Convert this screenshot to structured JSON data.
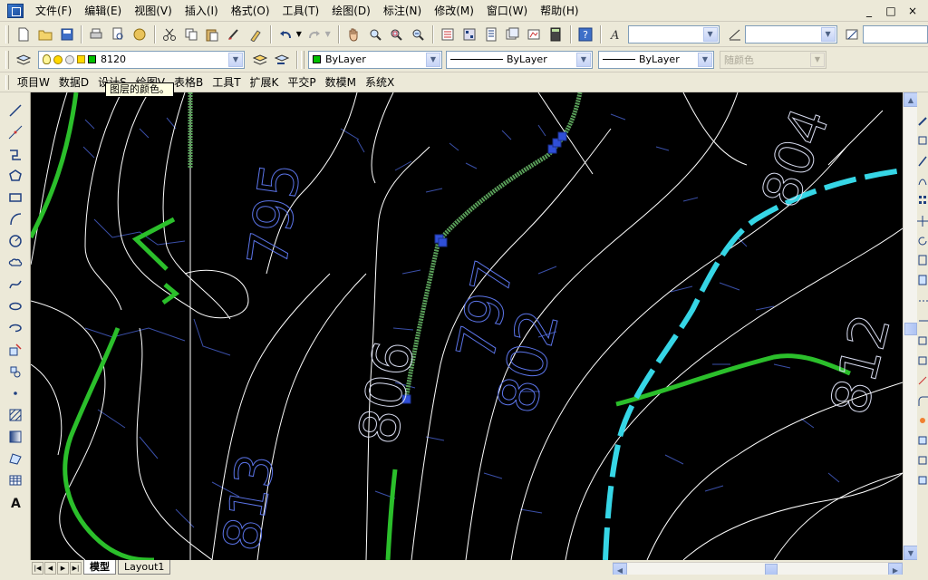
{
  "menubar": {
    "items": [
      "文件(F)",
      "编辑(E)",
      "视图(V)",
      "插入(I)",
      "格式(O)",
      "工具(T)",
      "绘图(D)",
      "标注(N)",
      "修改(M)",
      "窗口(W)",
      "帮助(H)"
    ],
    "window_controls": [
      "_",
      "□",
      "×"
    ]
  },
  "toolbar_icons": [
    "new-file-icon",
    "open-folder-icon",
    "save-icon",
    "print-icon",
    "print-preview-icon",
    "publish-icon",
    "cut-icon",
    "copy-icon",
    "paste-icon",
    "brush-icon",
    "match-properties-icon",
    "undo-icon",
    "redo-icon",
    "pan-icon",
    "zoom-realtime-icon",
    "zoom-window-icon",
    "zoom-previous-icon",
    "properties-icon",
    "design-center-icon",
    "tool-palettes-icon",
    "sheet-set-icon",
    "markup-icon",
    "calculator-icon",
    "help-icon"
  ],
  "layers": {
    "current_layer": "8120",
    "layer_color": "#00c000",
    "color_combo": "ByLayer",
    "linetype_combo": "ByLayer",
    "lineweight_combo": "ByLayer",
    "plot_style_combo": "随颜色"
  },
  "tooltip": "图层的颜色。",
  "menu3": {
    "items": [
      "项目W",
      "数据D",
      "设计S",
      "绘图V",
      "表格B",
      "工具T",
      "扩展K",
      "平交P",
      "数模M",
      "系统X"
    ]
  },
  "draw_tools": [
    "line-icon",
    "construction-line-icon",
    "polyline-icon",
    "polygon-icon",
    "rectangle-icon",
    "arc-icon",
    "circle-icon",
    "revision-cloud-icon",
    "spline-icon",
    "ellipse-icon",
    "ellipse-arc-icon",
    "insert-block-icon",
    "make-block-icon",
    "point-icon",
    "hatch-icon",
    "gradient-icon",
    "region-icon",
    "table-icon",
    "multiline-text-icon"
  ],
  "drawing": {
    "contour_labels": [
      "795",
      "813",
      "806",
      "802",
      "812",
      "804",
      "797"
    ],
    "colors": {
      "background": "#000000",
      "contour": "#ffffff",
      "index_contour": "#2bbf2b",
      "boundary": "#36d6e6",
      "label": "#5b74e8",
      "hatch": "#5aa05a",
      "grip": "#2f4fd8"
    }
  },
  "tabs": {
    "items": [
      "模型",
      "Layout1"
    ],
    "active": "模型"
  }
}
